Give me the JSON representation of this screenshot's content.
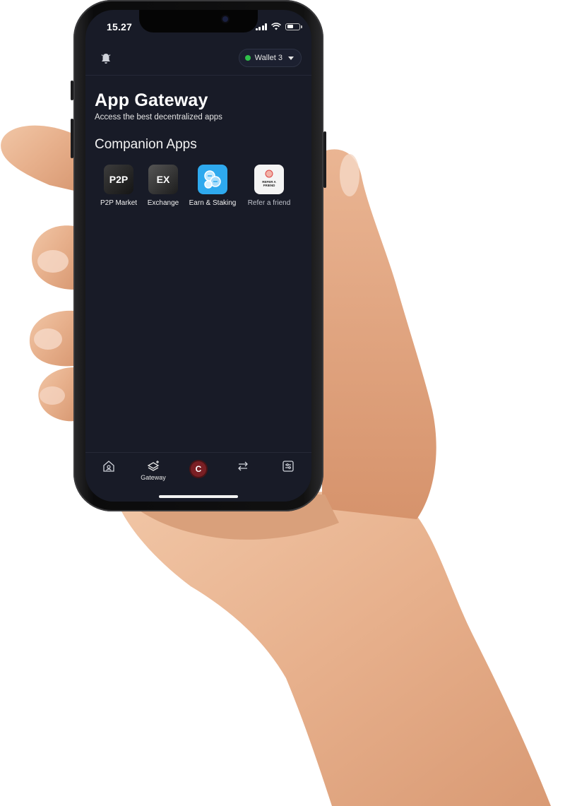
{
  "status_bar": {
    "time": "15.27"
  },
  "header": {
    "wallet_label": "Wallet 3",
    "wallet_status_color": "#2fbf4a",
    "icons": [
      "bell-icon",
      "chevron-down-icon"
    ]
  },
  "main": {
    "title": "App Gateway",
    "subtitle": "Access the best decentralized apps",
    "section_title": "Companion Apps",
    "apps": [
      {
        "label": "P2P Market",
        "icon_text": "P2P"
      },
      {
        "label": "Exchange",
        "icon_text": "EX"
      },
      {
        "label": "Earn & Staking",
        "icon": "coins-icon"
      },
      {
        "label": "Refer a friend",
        "icon_text": "REFER A FRIEND"
      }
    ]
  },
  "bottom_nav": {
    "items": [
      {
        "name": "home-icon"
      },
      {
        "name": "gateway-icon",
        "label": "Gateway"
      },
      {
        "name": "center-logo",
        "text": "C"
      },
      {
        "name": "swap-icon"
      },
      {
        "name": "settings-icon"
      }
    ]
  },
  "colors": {
    "screen_bg": "#181b27",
    "accent_red": "#7a1f24",
    "earn_blue": "#2ea9ee"
  }
}
